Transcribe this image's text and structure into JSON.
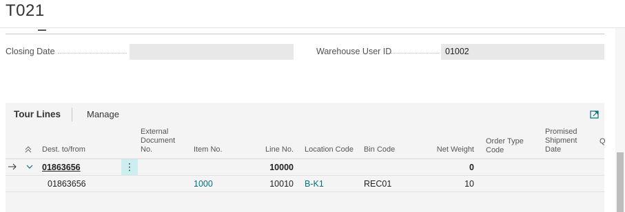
{
  "page": {
    "title": "T021"
  },
  "fields": {
    "closing_date": {
      "label": "Closing Date",
      "value": ""
    },
    "warehouse_user_id": {
      "label": "Warehouse User ID",
      "value": "01002"
    }
  },
  "tour_lines": {
    "tab_title": "Tour Lines",
    "manage_label": "Manage",
    "columns": {
      "dest": "Dest. to/from",
      "external_doc": "External Document No.",
      "item_no": "Item No.",
      "line_no": "Line No.",
      "location_code": "Location Code",
      "bin_code": "Bin Code",
      "net_weight": "Net Weight",
      "order_type_code": "Order Type Code",
      "promised_shipment_date": "Promised Shipment Date",
      "next_col_letter": "Q"
    },
    "rows": [
      {
        "dest": "01863656",
        "external_doc": "",
        "item_no": "",
        "line_no": "10000",
        "location_code": "",
        "bin_code": "",
        "net_weight": "0",
        "order_type_code": "",
        "promised_shipment_date": ""
      },
      {
        "dest": "01863656",
        "external_doc": "",
        "item_no": "1000",
        "line_no": "10010",
        "location_code": "B-K1",
        "bin_code": "REC01",
        "net_weight": "10",
        "order_type_code": "",
        "promised_shipment_date": ""
      }
    ]
  },
  "icons": {
    "row_pointer": "arrow-right-icon",
    "collapse_row": "chevron-down-icon",
    "collapse_all": "double-chevron-up-icon",
    "context_menu": "vertical-ellipsis-icon",
    "expand_panel": "expand-panel-icon"
  },
  "colors": {
    "link": "#00707d",
    "selected_cell": "#cdeef0",
    "field_box": "#e8e8e8",
    "card_background": "#f4f4f4"
  }
}
